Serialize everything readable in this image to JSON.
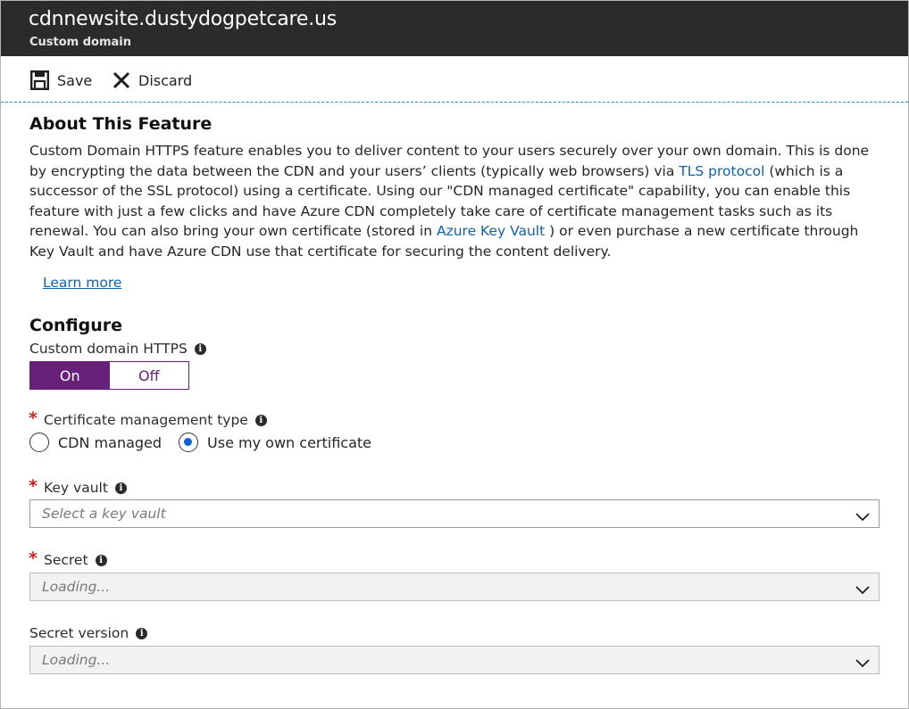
{
  "header": {
    "title": "cdnnewsite.dustydogpetcare.us",
    "subtitle": "Custom domain"
  },
  "toolbar": {
    "save_label": "Save",
    "discard_label": "Discard"
  },
  "about": {
    "heading": "About This Feature",
    "text_1": "Custom Domain HTTPS feature enables you to deliver content to your users securely over your own domain. This is done by encrypting the data between the CDN and your users’ clients (typically web browsers) via ",
    "tls_link": "TLS protocol",
    "text_2": " (which is a successor of the SSL protocol) using a certificate. Using our \"CDN managed certificate\" capability, you can enable this feature with just a few clicks and have Azure CDN completely take care of certificate management tasks such as its renewal. You can also bring your own certificate (stored in ",
    "keyvault_link": "Azure Key Vault",
    "text_3": " ) or even purchase a new certificate through Key Vault and have Azure CDN use that certificate for securing the content delivery.",
    "learn_more": "Learn more"
  },
  "configure": {
    "heading": "Configure",
    "https_label": "Custom domain HTTPS",
    "toggle_on": "On",
    "toggle_off": "Off",
    "toggle_selected": "On",
    "cert_type_label": "Certificate management type",
    "cert_options": [
      "CDN managed",
      "Use my own certificate"
    ],
    "cert_selected": "Use my own certificate",
    "key_vault_label": "Key vault",
    "key_vault_placeholder": "Select a key vault",
    "secret_label": "Secret",
    "secret_placeholder": "Loading...",
    "secret_version_label": "Secret version",
    "secret_version_placeholder": "Loading..."
  },
  "colors": {
    "title_bar": "#2b2b2b",
    "toggle_accent": "#68217a",
    "link": "#0f62ad",
    "required": "#d21f1f",
    "radio_dot": "#0f62d6"
  },
  "icons": [
    "save-icon",
    "discard-icon",
    "info-icon",
    "chevron-down-icon"
  ]
}
